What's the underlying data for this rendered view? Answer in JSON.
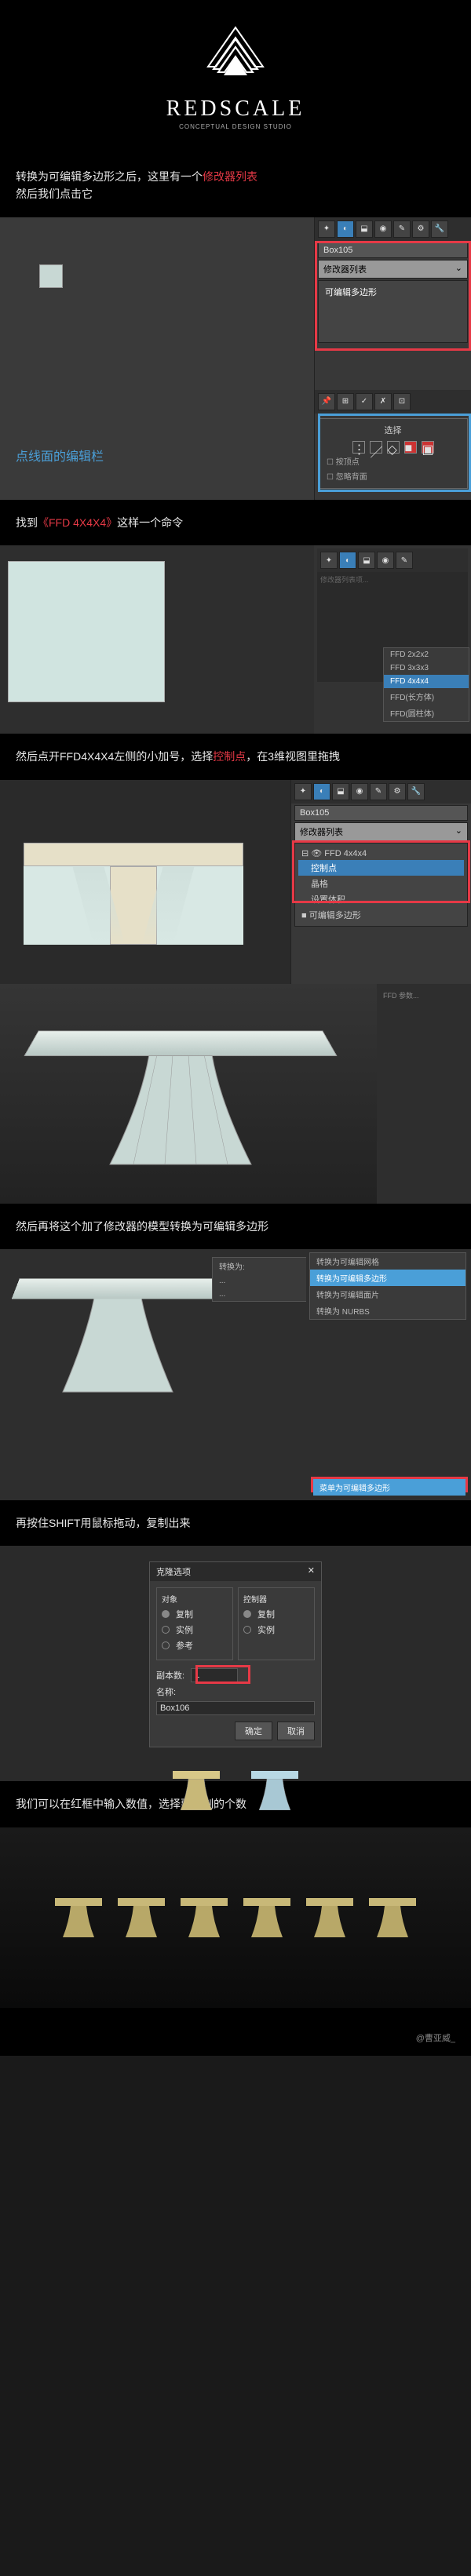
{
  "logo": {
    "title": "REDSCALE",
    "subtitle": "CONCEPTUAL DESIGN STUDIO"
  },
  "steps": {
    "s1": {
      "text_before": "转换为可编辑多边形之后，这里有一个",
      "highlight": "修改器列表",
      "text_after": "然后我们点击它",
      "object_name": "Box105",
      "dropdown": "修改器列表",
      "mod_item": "可编辑多边形",
      "select_label": "选择",
      "blue_label": "点线面的编辑栏",
      "check1": "按顶点",
      "check2": "忽略背面"
    },
    "s2": {
      "text_before": "找到",
      "highlight": "《FFD 4X4X4》",
      "text_after": "这样一个命令",
      "menu_items": [
        "FFD 2x2x2",
        "FFD 3x3x3",
        "FFD 4x4x4",
        "FFD(长方体)",
        "FFD(圆柱体)"
      ]
    },
    "s3": {
      "text_before": "然后点开FFD4X4X4左侧的小加号，选择",
      "highlight": "控制点",
      "text_after": "，在3维视图里拖拽",
      "object_name": "Box105",
      "dropdown": "修改器列表",
      "mod_ffd": "FFD 4x4x4",
      "mod_control": "控制点",
      "mod_lattice": "晶格",
      "mod_setvolume": "设置体积",
      "mod_editable": "可编辑多边形"
    },
    "s4": {
      "text": "然后再将这个加了修改器的模型转换为可编辑多边形",
      "menu_convert": "转换为可编辑多边形",
      "menu_highlight": "菜单为可编辑多边形"
    },
    "s5": {
      "text": "再按住SHIFT用鼠标拖动，复制出来",
      "dialog_title": "克隆选项",
      "group1_label": "对象",
      "group2_label": "控制器",
      "opt_copy": "复制",
      "opt_instance": "实例",
      "opt_reference": "参考",
      "count_label": "副本数:",
      "count_value": "1",
      "name_label": "名称:",
      "name_value": "Box106",
      "btn_ok": "确定",
      "btn_cancel": "取消"
    },
    "s6": {
      "text": "我们可以在红框中输入数值，选择要复制的个数"
    }
  },
  "footer": {
    "credit": "@曹亚威_"
  }
}
